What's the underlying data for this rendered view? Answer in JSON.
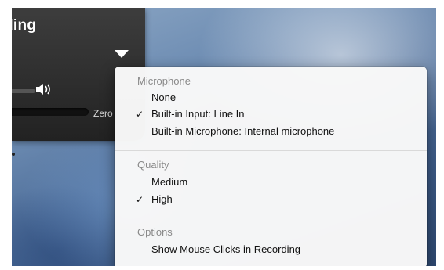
{
  "recording_window": {
    "title": "ding",
    "size_readout": "Zero"
  },
  "menu": {
    "sections": [
      {
        "header": "Microphone",
        "items": [
          {
            "label": "None",
            "checked": false
          },
          {
            "label": "Built-in Input: Line In",
            "checked": true
          },
          {
            "label": "Built-in Microphone: Internal microphone",
            "checked": false
          }
        ]
      },
      {
        "header": "Quality",
        "items": [
          {
            "label": "Medium",
            "checked": false
          },
          {
            "label": "High",
            "checked": true
          }
        ]
      },
      {
        "header": "Options",
        "items": [
          {
            "label": "Show Mouse Clicks in Recording",
            "checked": false
          }
        ]
      }
    ],
    "check_glyph": "✓"
  },
  "icons": {
    "options_arrow": "chevron-down-icon",
    "volume": "speaker-icon"
  }
}
